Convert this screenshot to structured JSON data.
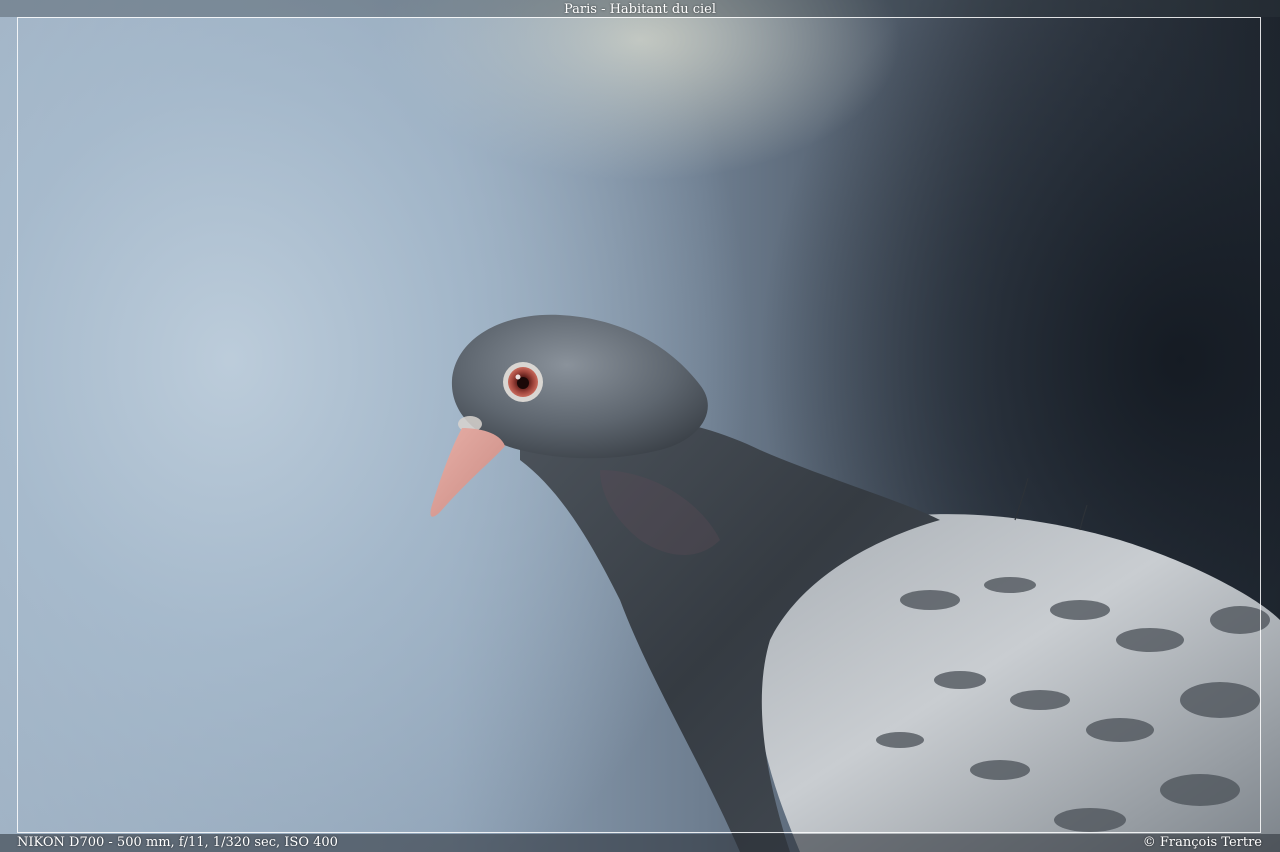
{
  "photo": {
    "title": "Paris - Habitant du ciel",
    "exif": "NIKON D700 - 500 mm, f/11, 1/320 sec, ISO 400",
    "credit": "© François Tertre"
  }
}
